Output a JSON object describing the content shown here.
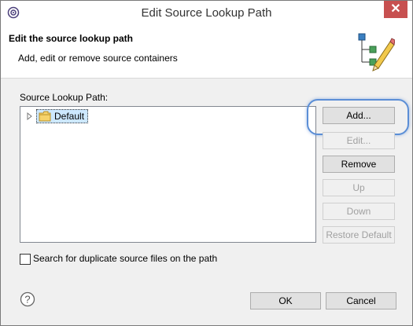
{
  "window": {
    "title": "Edit Source Lookup Path",
    "close_glyph": "✕"
  },
  "banner": {
    "title": "Edit the source lookup path",
    "subtitle": "Add, edit or remove source containers"
  },
  "list": {
    "label": "Source Lookup Path:",
    "items": [
      {
        "label": "Default",
        "icon": "folder-icon",
        "expanded": false
      }
    ]
  },
  "buttons": {
    "add": "Add...",
    "edit": "Edit...",
    "remove": "Remove",
    "up": "Up",
    "down": "Down",
    "restore": "Restore Default"
  },
  "options": {
    "duplicates_label": "Search for duplicate source files on the path",
    "duplicates_checked": false
  },
  "footer": {
    "ok": "OK",
    "cancel": "Cancel",
    "help_glyph": "?"
  },
  "colors": {
    "accent_highlight": "#5b8ed6",
    "close": "#c75050",
    "selection": "#cde8ff"
  }
}
